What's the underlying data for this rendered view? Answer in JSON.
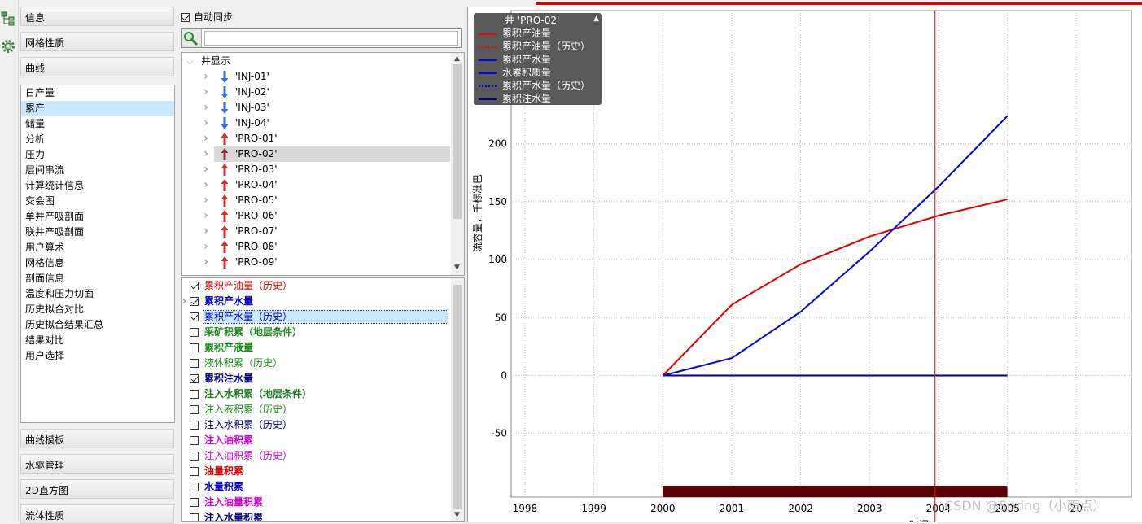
{
  "left_panel": {
    "sections_top": [
      "信息",
      "网格性质",
      "曲线"
    ],
    "curve_items": [
      "日产量",
      "累产",
      "储量",
      "分析",
      "压力",
      "层间串流",
      "计算统计信息",
      "交会图",
      "单井产吸剖面",
      "联井产吸剖面",
      "用户算术",
      "网格信息",
      "剖面信息",
      "温度和压力切面",
      "历史拟合对比",
      "历史拟合结果汇总",
      "结果对比",
      "用户选择"
    ],
    "selected_curve_index": 1,
    "sections_bottom": [
      "曲线模板",
      "水驱管理",
      "2D直方图",
      "流体性质"
    ]
  },
  "middle_panel": {
    "auto_sync_label": "自动同步",
    "auto_sync_checked": true,
    "search": {
      "value": "",
      "placeholder": ""
    },
    "tree_root": "井显示",
    "wells": [
      {
        "name": "'INJ-01'",
        "kind": "inj"
      },
      {
        "name": "'INJ-02'",
        "kind": "inj"
      },
      {
        "name": "'INJ-03'",
        "kind": "inj"
      },
      {
        "name": "'INJ-04'",
        "kind": "inj"
      },
      {
        "name": "'PRO-01'",
        "kind": "pro"
      },
      {
        "name": "'PRO-02'",
        "kind": "pro",
        "selected": true
      },
      {
        "name": "'PRO-03'",
        "kind": "pro"
      },
      {
        "name": "'PRO-04'",
        "kind": "pro"
      },
      {
        "name": "'PRO-05'",
        "kind": "pro"
      },
      {
        "name": "'PRO-06'",
        "kind": "pro"
      },
      {
        "name": "'PRO-07'",
        "kind": "pro"
      },
      {
        "name": "'PRO-08'",
        "kind": "pro"
      },
      {
        "name": "'PRO-09'",
        "kind": "pro"
      }
    ],
    "properties": [
      {
        "label": "累积产油量（历史）",
        "checked": true,
        "color": "#e00000",
        "bold": false
      },
      {
        "label": "累积产水量",
        "checked": true,
        "color": "#0000c8",
        "bold": true,
        "expand": true
      },
      {
        "label": "累积产水量（历史）",
        "checked": true,
        "color": "#0000c8",
        "bold": false,
        "selected": true
      },
      {
        "label": "采矿积累（地层条件）",
        "checked": false,
        "color": "#1a8a1a",
        "bold": true
      },
      {
        "label": "累积产液量",
        "checked": false,
        "color": "#1a8a1a",
        "bold": true
      },
      {
        "label": "液体积累（历史）",
        "checked": false,
        "color": "#1a8a1a",
        "bold": false
      },
      {
        "label": "累积注水量",
        "checked": true,
        "color": "#00007a",
        "bold": true
      },
      {
        "label": "注入水积累（地层条件）",
        "checked": false,
        "color": "#1a7a1a",
        "bold": true
      },
      {
        "label": "注入液积累（历史）",
        "checked": false,
        "color": "#1a8a1a",
        "bold": false
      },
      {
        "label": "注入水积累（历史）",
        "checked": false,
        "color": "#00007a",
        "bold": false
      },
      {
        "label": "注入油积累",
        "checked": false,
        "color": "#d000d0",
        "bold": true
      },
      {
        "label": "注入油积累（历史）",
        "checked": false,
        "color": "#d000d0",
        "bold": false
      },
      {
        "label": "油量积累",
        "checked": false,
        "color": "#e00000",
        "bold": true
      },
      {
        "label": "水量积累",
        "checked": false,
        "color": "#0000c8",
        "bold": true
      },
      {
        "label": "注入油量积累",
        "checked": false,
        "color": "#d000d0",
        "bold": true
      },
      {
        "label": "注入水量积累",
        "checked": false,
        "color": "#00007a",
        "bold": true
      }
    ]
  },
  "chart_data": {
    "type": "line",
    "ylabel": "流容量，千标准巴",
    "xlabel": "时间",
    "x_ticks": [
      "1998",
      "1999",
      "2000",
      "2001",
      "2002",
      "2003",
      "2004",
      "2005",
      "20"
    ],
    "y_ticks": [
      "-50",
      "0",
      "50",
      "100",
      "150",
      "200"
    ],
    "xlim": [
      1997.8,
      2006.8
    ],
    "ylim": [
      -105,
      315
    ],
    "grid": true,
    "legend_position": "top-left",
    "legend_title": "井 'PRO-02'",
    "legend": [
      {
        "name": "累积产油量",
        "color": "#ff0000",
        "style": "solid"
      },
      {
        "name": "累积产油量（历史）",
        "color": "#ff0000",
        "style": "dotted"
      },
      {
        "name": "累积产水量",
        "color": "#0000ff",
        "style": "solid"
      },
      {
        "name": "水累积质量",
        "color": "#0000ff",
        "style": "solid"
      },
      {
        "name": "累积产水量（历史）",
        "color": "#0000ff",
        "style": "dotted"
      },
      {
        "name": "累积注水量",
        "color": "#000080",
        "style": "solid"
      }
    ],
    "series": [
      {
        "name": "累积产油量",
        "color": "#e00000",
        "x": [
          2000,
          2001,
          2002,
          2003,
          2004,
          2005
        ],
        "y": [
          0,
          61,
          96,
          120,
          138,
          152
        ]
      },
      {
        "name": "累积产水量",
        "color": "#0000e0",
        "x": [
          2000,
          2001,
          2002,
          2003,
          2004,
          2005
        ],
        "y": [
          0,
          15,
          55,
          107,
          163,
          224
        ]
      },
      {
        "name": "累积注水量",
        "color": "#000080",
        "x": [
          2000,
          2005
        ],
        "y": [
          0,
          0
        ]
      }
    ],
    "cursor_x": 2003.95,
    "cursor_color": "#e00000",
    "bar": {
      "from": 2000,
      "to": 2005,
      "color": "#5a0000"
    }
  },
  "watermark": "CSDN @Spring（小雨点）",
  "colors": {
    "inj_arrow": "#3a6fd8",
    "pro_arrow": "#d03030",
    "pro_arrow_selected": "#8a3040"
  }
}
